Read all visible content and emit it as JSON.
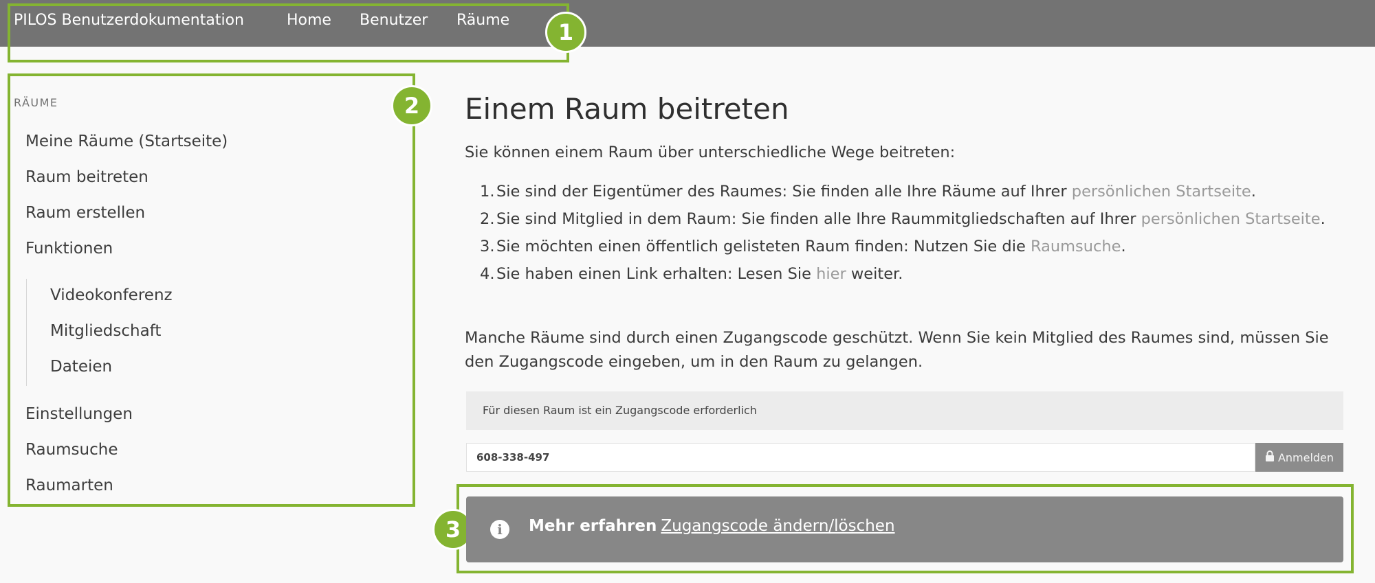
{
  "nav": {
    "brand": "PILOS Benutzerdokumentation",
    "items": [
      "Home",
      "Benutzer",
      "Räume"
    ]
  },
  "annotations": {
    "one": "1",
    "two": "2",
    "three": "3"
  },
  "sidebar": {
    "section_title": "RÄUME",
    "items": [
      "Meine Räume (Startseite)",
      "Raum beitreten",
      "Raum erstellen",
      "Funktionen",
      "Videokonferenz",
      "Mitgliedschaft",
      "Dateien",
      "Einstellungen",
      "Raumsuche",
      "Raumarten"
    ]
  },
  "main": {
    "heading": "Einem Raum beitreten",
    "intro": "Sie können einem Raum über unterschiedliche Wege beitreten:",
    "list": [
      {
        "num": "1.",
        "text": "Sie sind der Eigentümer des Raumes: Sie finden alle Ihre Räume auf Ihrer ",
        "link": "persönlichen Startseite",
        "after": "."
      },
      {
        "num": "2.",
        "text": "Sie sind Mitglied in dem Raum: Sie finden alle Ihre Raummitgliedschaften auf Ihrer ",
        "link": "persönlichen Startseite",
        "after": "."
      },
      {
        "num": "3.",
        "text": "Sie möchten einen öffentlich gelisteten Raum finden: Nutzen Sie die ",
        "link": "Raumsuche",
        "after": "."
      },
      {
        "num": "4.",
        "text": "Sie haben einen Link erhalten: Lesen Sie ",
        "link": "hier",
        "after": " weiter."
      }
    ],
    "access_paragraph": "Manche Räume sind durch einen Zugangscode geschützt. Wenn Sie kein Mitglied des Raumes sind, müssen Sie den Zugangscode eingeben, um in den Raum zu gelangen.",
    "access_mock": {
      "header": "Für diesen Raum ist ein Zugangscode erforderlich",
      "code_value": "608-338-497",
      "button_label": "Anmelden",
      "button_icon": "lock-icon"
    },
    "info": {
      "icon": "info-icon",
      "bold": "Mehr erfahren",
      "link": "Zugangscode ändern/löschen"
    }
  },
  "colors": {
    "topbar": "#737373",
    "annotation": "#84b431",
    "info_box": "#878787",
    "link": "#9a9a9a"
  }
}
